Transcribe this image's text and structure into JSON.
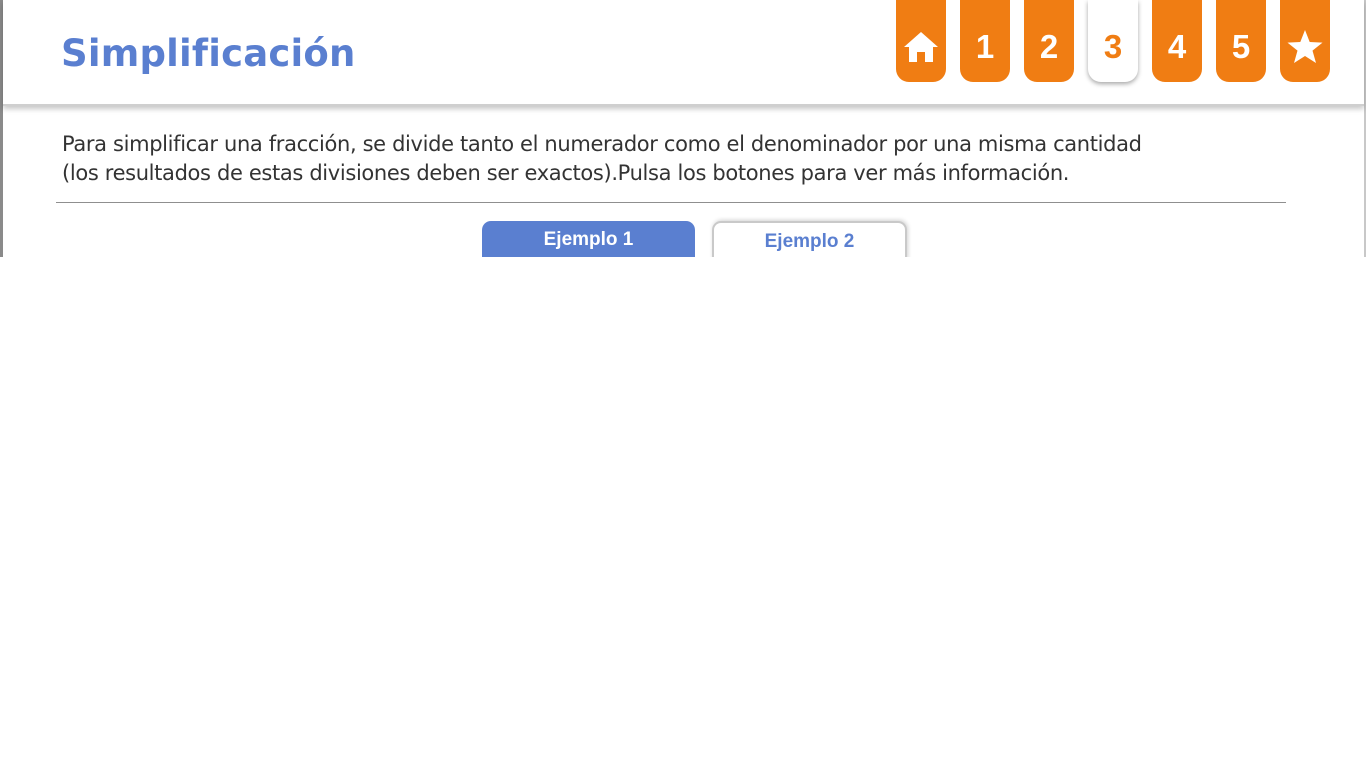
{
  "header": {
    "title": "Simplificación"
  },
  "nav": {
    "tabs": [
      {
        "label": "",
        "icon": "home-icon"
      },
      {
        "label": "1"
      },
      {
        "label": "2"
      },
      {
        "label": "3",
        "active": true
      },
      {
        "label": "4"
      },
      {
        "label": "5"
      },
      {
        "label": "",
        "icon": "star-icon"
      }
    ]
  },
  "content": {
    "intro_line1": "Para simplificar una fracción, se divide tanto el numerador como el denominador por una misma cantidad",
    "intro_line2": "(los resultados de estas divisiones deben ser exactos).Pulsa los botones para ver más información."
  },
  "tabs": {
    "example1": "Ejemplo 1",
    "example2": "Ejemplo 2"
  },
  "colors": {
    "accent_orange": "#f07d13",
    "accent_blue": "#5a7fd0",
    "text": "#333333"
  }
}
